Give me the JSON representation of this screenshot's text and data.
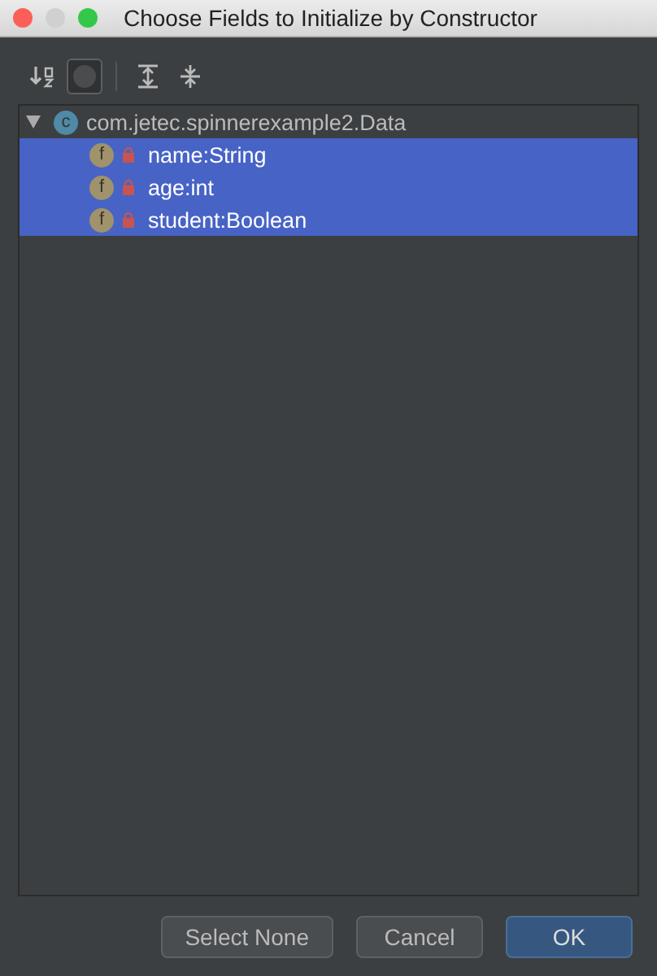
{
  "window": {
    "title": "Choose Fields to Initialize by Constructor"
  },
  "toolbar": [
    {
      "kind": "sort",
      "pressed": false
    },
    {
      "kind": "classes",
      "pressed": true
    },
    {
      "kind": "expand",
      "pressed": false
    },
    {
      "kind": "collapse",
      "pressed": false
    }
  ],
  "tree": {
    "label": "com.jetec.spinnerexample2.Data",
    "badge": "c",
    "expanded": true,
    "children": [
      {
        "label": "name:String",
        "badge": "f",
        "selected": true
      },
      {
        "label": "age:int",
        "badge": "f",
        "selected": true
      },
      {
        "label": "student:Boolean",
        "badge": "f",
        "selected": true
      }
    ]
  },
  "buttons": [
    {
      "label": "Select None",
      "default": false
    },
    {
      "label": "Cancel",
      "default": false
    },
    {
      "label": "OK",
      "default": true
    }
  ]
}
